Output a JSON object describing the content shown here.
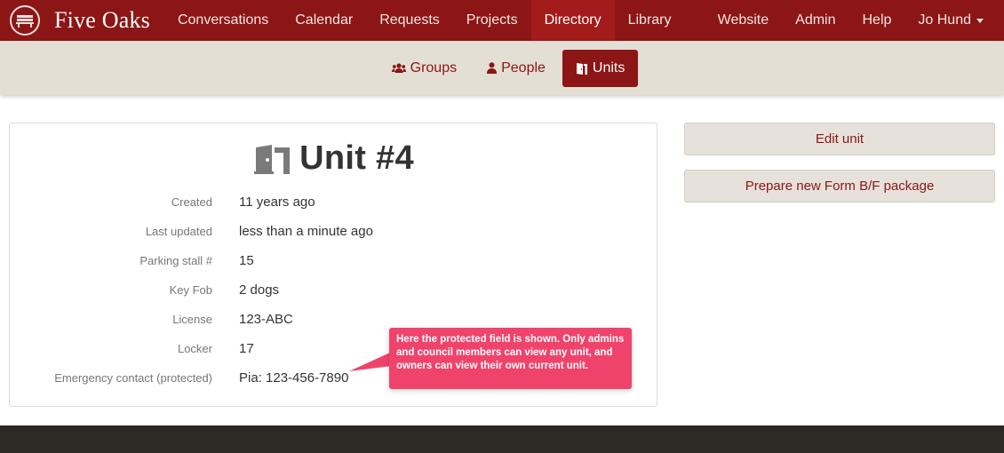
{
  "brand": {
    "name": "Five Oaks",
    "logo_icon": "bench-logo-icon"
  },
  "nav": {
    "left": [
      "Conversations",
      "Calendar",
      "Requests",
      "Projects",
      "Directory",
      "Library"
    ],
    "active": "Directory",
    "right": [
      "Website",
      "Admin",
      "Help"
    ],
    "user": "Jo Hund"
  },
  "subnav": {
    "items": [
      {
        "label": "Groups",
        "icon": "users-icon"
      },
      {
        "label": "People",
        "icon": "person-icon"
      },
      {
        "label": "Units",
        "icon": "door-icon"
      }
    ],
    "active": "Units"
  },
  "unit": {
    "title": "Unit #4",
    "title_icon": "door-open-icon",
    "fields": [
      {
        "label": "Created",
        "value": "11 years ago"
      },
      {
        "label": "Last updated",
        "value": "less than a minute ago"
      },
      {
        "label": "Parking stall #",
        "value": "15"
      },
      {
        "label": "Key Fob",
        "value": "2 dogs"
      },
      {
        "label": "License",
        "value": "123-ABC"
      },
      {
        "label": "Locker",
        "value": "17"
      },
      {
        "label": "Emergency contact (protected)",
        "value": "Pia: 123-456-7890"
      }
    ]
  },
  "tooltip": "Here the protected field is shown. Only admins and council members can view any unit, and owners can view their own current unit.",
  "actions": {
    "edit": "Edit unit",
    "prepare": "Prepare new Form B/F package"
  },
  "colors": {
    "primary": "#8c1515",
    "subnav_bg": "#e4dfd4",
    "tooltip": "#f0436b",
    "footer": "#2d2a26"
  }
}
